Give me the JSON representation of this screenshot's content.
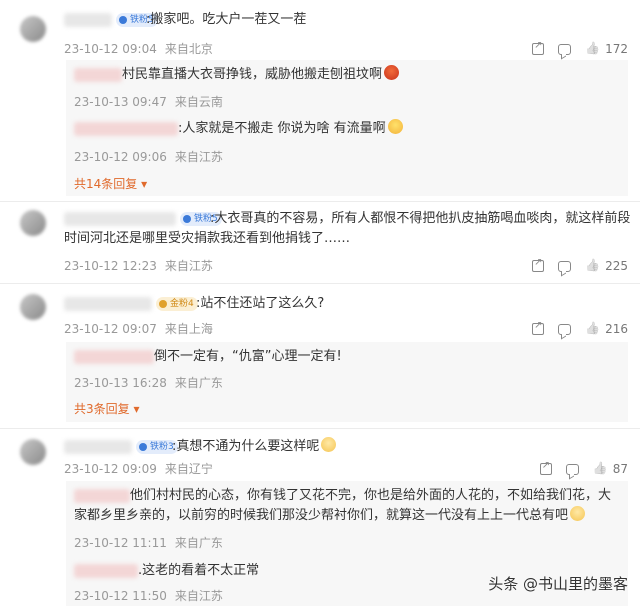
{
  "comments": [
    {
      "badge": "铁粉5",
      "text": "搬家吧。吃大户一茬又一茬",
      "time": "23-10-12 09:04",
      "location": "来自北京",
      "likes": "172",
      "replies": [
        {
          "text": "村民靠直播大衣哥挣钱，威胁他搬走刨祖坟啊",
          "time": "23-10-13 09:47",
          "location": "来自云南"
        },
        {
          "text": "人家就是不搬走 你说为啥  有流量啊",
          "time": "23-10-12 09:06",
          "location": "来自江苏"
        }
      ],
      "more": "共14条回复 ▾"
    },
    {
      "badge": "铁粉5",
      "text": "大衣哥真的不容易，所有人都恨不得把他扒皮抽筋喝血啖肉，就这样前段时间河北还是哪里受灾捐款我还看到他捐钱了……",
      "time": "23-10-12 12:23",
      "location": "来自江苏",
      "likes": "225"
    },
    {
      "badge": "金粉4",
      "text": "站不住还站了这么久?",
      "time": "23-10-12 09:07",
      "location": "来自上海",
      "likes": "216",
      "replies": [
        {
          "text": "倒不一定有，“仇富”心理一定有!",
          "time": "23-10-13 16:28",
          "location": "来自广东"
        }
      ],
      "more": "共3条回复 ▾"
    },
    {
      "badge": "铁粉3",
      "text": "真想不通为什么要这样呢",
      "time": "23-10-12 09:09",
      "location": "来自辽宁",
      "likes": "87",
      "replies": [
        {
          "text": "他们村村民的心态，你有钱了又花不完，你也是给外面的人花的，不如给我们花，大家都乡里乡亲的，以前穷的时候我们那没少帮衬你们，就算这一代没有上上一代总有吧",
          "time": "23-10-12 11:11",
          "location": "来自广东"
        },
        {
          "text": "这老的看着不太正常",
          "time": "23-10-12 11:50",
          "location": "来自江苏"
        }
      ]
    }
  ],
  "watermark": "头条 @书山里的墨客"
}
